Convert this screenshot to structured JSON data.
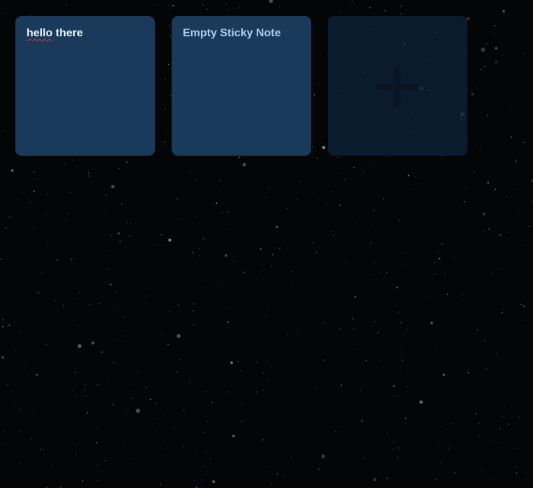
{
  "notes": [
    {
      "text_prefix": "hello",
      "text_suffix": " there"
    },
    {
      "text": "Empty Sticky Note"
    }
  ],
  "add_button": {
    "icon": "plus-icon"
  },
  "colors": {
    "background": "#040506",
    "note_bg": "#193a5b",
    "note_text": "#eef3f8",
    "placeholder_text": "#a9cde9",
    "add_card_bg": "#0d213a",
    "plus_icon": "#0a1524",
    "spellcheck_underline": "#d63a3a"
  }
}
